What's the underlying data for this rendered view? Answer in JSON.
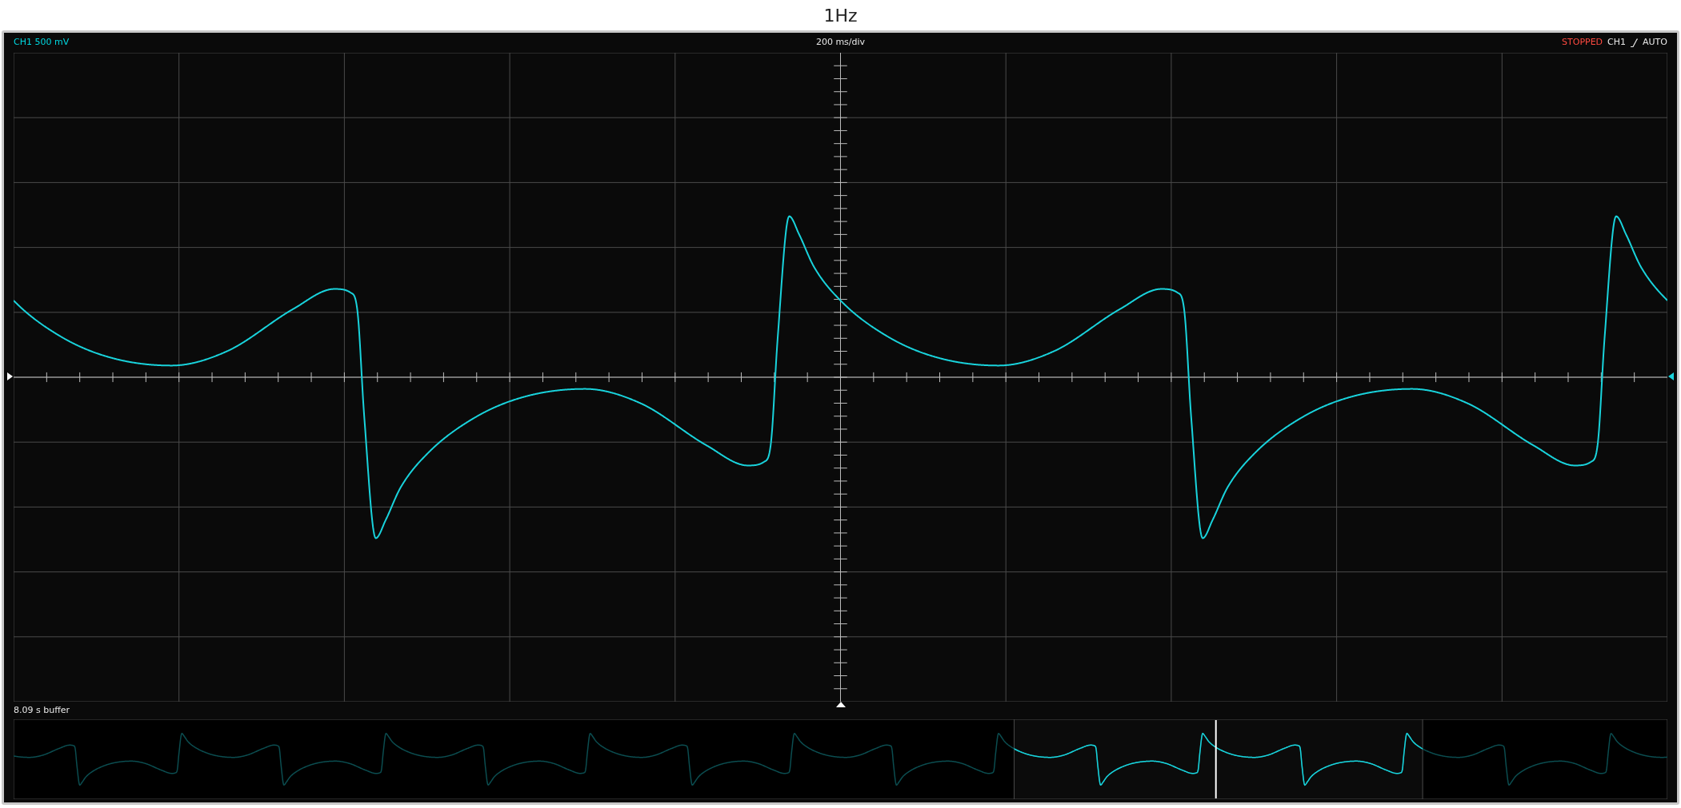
{
  "title": "1Hz",
  "header": {
    "channel_label": "CH1 500 mV",
    "timebase": "200 ms/div",
    "status": "STOPPED",
    "trigger_channel": "CH1",
    "trigger_mode": "AUTO"
  },
  "buffer": {
    "label": "8.09 s buffer"
  }
}
